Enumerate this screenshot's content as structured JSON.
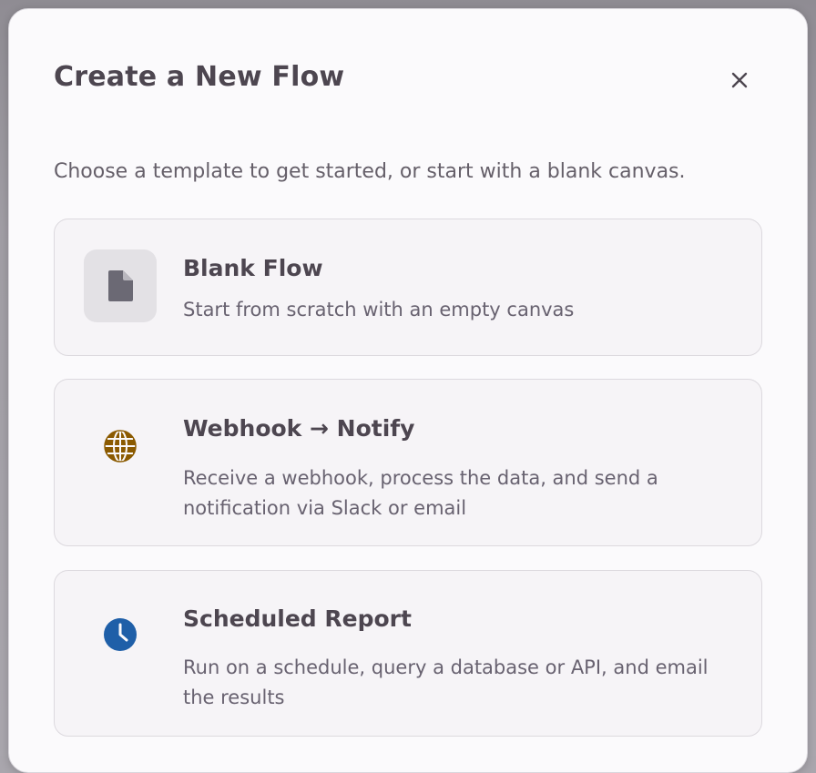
{
  "dialog": {
    "title": "Create a New Flow",
    "close_symbol": "×",
    "subtitle": "Choose a template to get started, or start with a blank canvas."
  },
  "templates": [
    {
      "title": "Blank Flow",
      "description": "Start from scratch with an empty canvas",
      "icon": "document-icon",
      "icon_color": "#6b6974"
    },
    {
      "title": "Webhook → Notify",
      "description": "Receive a webhook, process the data, and send a notification via Slack or email",
      "icon": "globe-icon",
      "icon_color": "#8b5a00"
    },
    {
      "title": "Scheduled Report",
      "description": "Run on a schedule, query a database or API, and email the results",
      "icon": "clock-icon",
      "icon_color": "#1f5fa8"
    }
  ]
}
